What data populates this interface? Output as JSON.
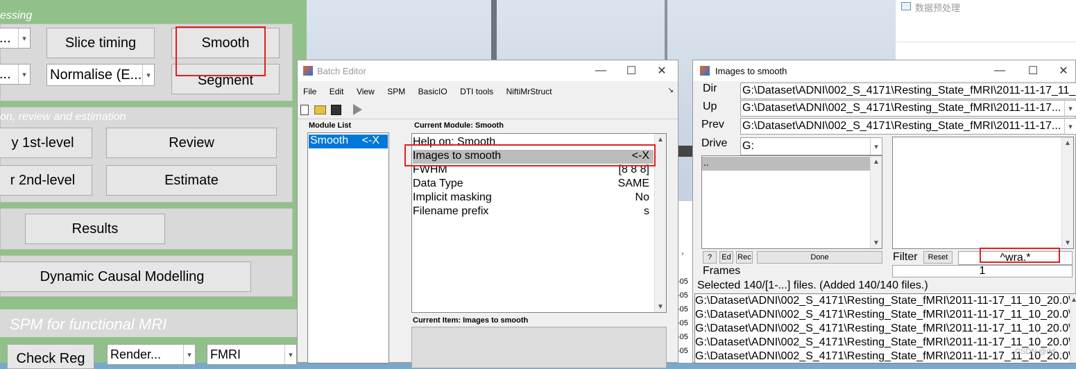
{
  "spm_main": {
    "section_preprocessing": "essing",
    "dropdown_1": "...",
    "dropdown_2": "...",
    "slice_timing": "Slice timing",
    "smooth": "Smooth",
    "normalise": "Normalise (E...",
    "segment": "Segment",
    "section_model": "on, review and estimation",
    "first_level": "y 1st-level",
    "review": "Review",
    "second_level": "r 2nd-level",
    "estimate": "Estimate",
    "results": "Results",
    "dcm": "Dynamic Causal Modelling",
    "footer_title": "SPM for functional MRI",
    "check_reg": "Check Reg",
    "render": "Render...",
    "fmri": "FMRI"
  },
  "background_window": {
    "label": "数据预处理"
  },
  "batch_editor": {
    "title": "Batch Editor",
    "menu": [
      "File",
      "Edit",
      "View",
      "SPM",
      "BasicIO",
      "DTI tools",
      "NiftiMrStruct"
    ],
    "module_list_label": "Module List",
    "module_item": "Smooth",
    "module_item_marker": "<-X",
    "current_module_label": "Current Module: Smooth",
    "rows": [
      {
        "label": "Help on: Smooth",
        "value": ""
      },
      {
        "label": "Images to smooth",
        "value": "<-X"
      },
      {
        "label": "FWHM",
        "value": "[8 8 8]"
      },
      {
        "label": "Data Type",
        "value": "SAME"
      },
      {
        "label": "Implicit masking",
        "value": "No"
      },
      {
        "label": "Filename prefix",
        "value": "s"
      }
    ],
    "current_item_label": "Current Item: Images to smooth"
  },
  "file_selector": {
    "title": "Images to smooth",
    "dir_label": "Dir",
    "dir_value": "G:\\Dataset\\ADNI\\002_S_4171\\Resting_State_fMRI\\2011-11-17_11_",
    "up_label": "Up",
    "up_value": "G:\\Dataset\\ADNI\\002_S_4171\\Resting_State_fMRI\\2011-11-17...",
    "prev_label": "Prev",
    "prev_value": "G:\\Dataset\\ADNI\\002_S_4171\\Resting_State_fMRI\\2011-11-17...",
    "drive_label": "Drive",
    "drive_value": "G:",
    "dir_list_item": "..",
    "btn_help": "?",
    "btn_ed": "Ed",
    "btn_rec": "Rec",
    "btn_done": "Done",
    "filter_label": "Filter",
    "btn_reset": "Reset",
    "filter_value": "^wra.*",
    "frames_label": "Frames",
    "frames_value": "1",
    "status": "Selected 140/[1-...] files. (Added 140/140 files.)",
    "files": [
      "G:\\Dataset\\ADNI\\002_S_4171\\Resting_State_fMRI\\2011-11-17_11_10_20.0\\",
      "G:\\Dataset\\ADNI\\002_S_4171\\Resting_State_fMRI\\2011-11-17_11_10_20.0\\",
      "G:\\Dataset\\ADNI\\002_S_4171\\Resting_State_fMRI\\2011-11-17_11_10_20.0\\",
      "G:\\Dataset\\ADNI\\002_S_4171\\Resting_State_fMRI\\2011-11-17_11_10_20.0\\",
      "G:\\Dataset\\ADNI\\002_S_4171\\Resting_State_fMRI\\2011-11-17_11_10_20.0\\"
    ],
    "watermark": "CSDN @dd_..."
  },
  "side_strip": {
    "labels": [
      "-05",
      "-05",
      "-05",
      "-05",
      "-05",
      "-05",
      "-05",
      "-05"
    ]
  }
}
